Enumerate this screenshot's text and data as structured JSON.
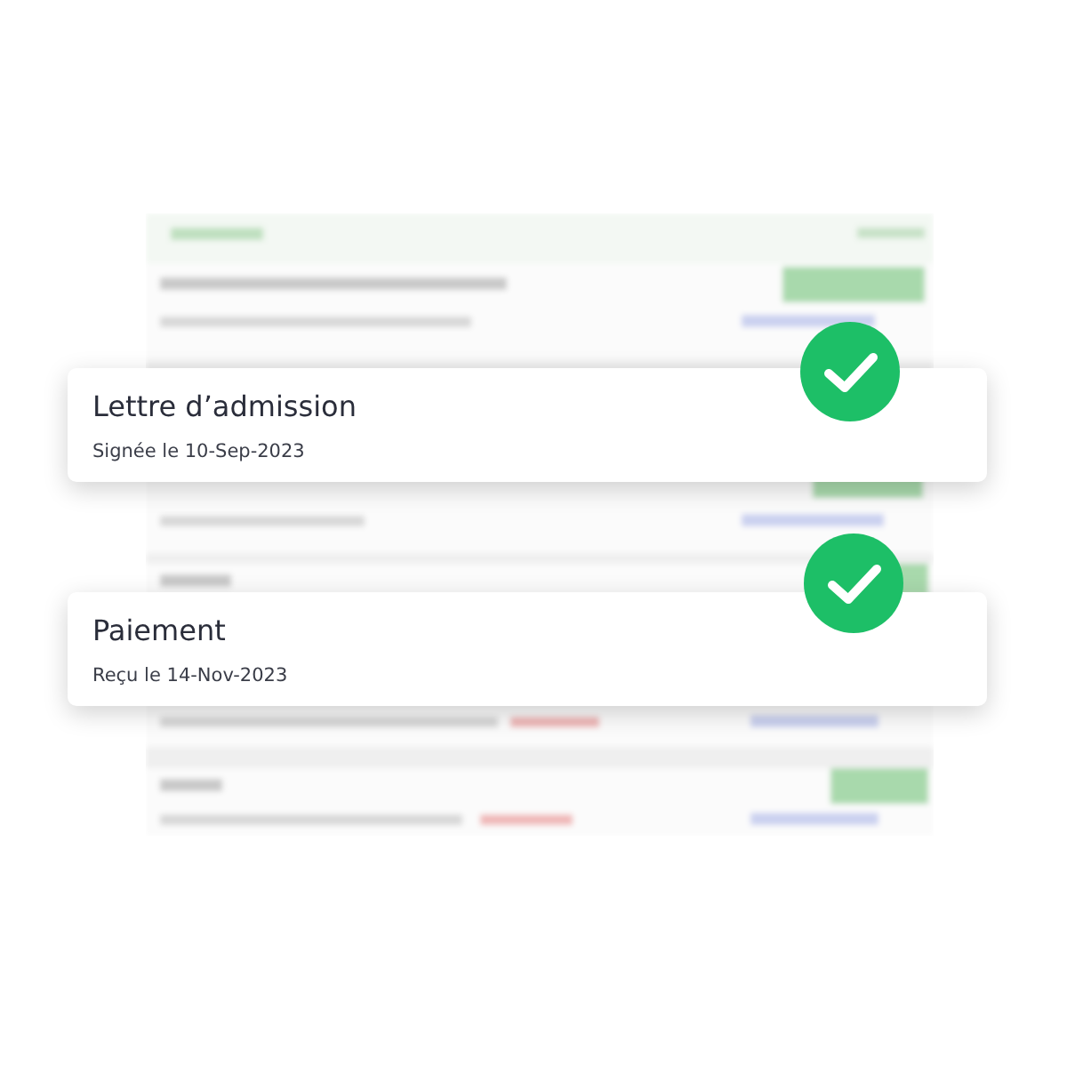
{
  "cards": [
    {
      "title": "Lettre d’admission",
      "subtitle": "Signée le 10-Sep-2023",
      "completed": true
    },
    {
      "title": "Paiement",
      "subtitle": "Reçu le 14-Nov-2023",
      "completed": true
    }
  ]
}
